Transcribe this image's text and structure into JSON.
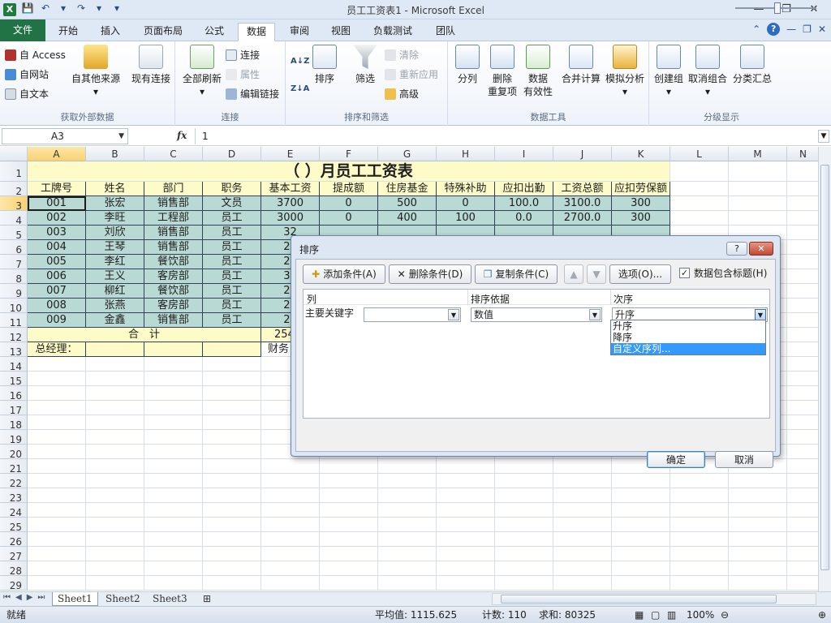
{
  "window": {
    "title": "员工工资表1 - Microsoft Excel",
    "minimize": "—",
    "restore": "❐",
    "close": "✕"
  },
  "qat": [
    "💾",
    "↶",
    "▾",
    "↷",
    "▾",
    "▾"
  ],
  "tabs": {
    "file": "文件",
    "items": [
      "开始",
      "插入",
      "页面布局",
      "公式",
      "数据",
      "审阅",
      "视图",
      "负载测试",
      "团队"
    ]
  },
  "ribbon": {
    "get_external": {
      "access": "自 Access",
      "web": "自网站",
      "text": "自文本",
      "other": "自其他来源",
      "existing": "现有连接",
      "label": "获取外部数据"
    },
    "connections": {
      "refresh_all": "全部刷新",
      "connections": "连接",
      "properties": "属性",
      "edit_links": "编辑链接",
      "label": "连接"
    },
    "sort_filter": {
      "sort_az": "A↓Z",
      "sort_za": "Z↓A",
      "sort": "排序",
      "filter": "筛选",
      "clear": "清除",
      "reapply": "重新应用",
      "advanced": "高级",
      "label": "排序和筛选"
    },
    "data_tools": {
      "text_to_columns": "分列",
      "remove_dup": "删除",
      "remove_dup2": "重复项",
      "validation": "数据",
      "validation2": "有效性",
      "consolidate": "合并计算",
      "what_if": "模拟分析",
      "label": "数据工具"
    },
    "outline": {
      "group": "创建组",
      "ungroup": "取消组合",
      "subtotal": "分类汇总",
      "label": "分级显示"
    }
  },
  "formula_bar": {
    "cell_ref": "A3",
    "fx": "fx",
    "value": "1"
  },
  "columns": [
    "A",
    "B",
    "C",
    "D",
    "E",
    "F",
    "G",
    "H",
    "I",
    "J",
    "K",
    "L",
    "M",
    "N"
  ],
  "rows": [
    "1",
    "2",
    "3",
    "4",
    "5",
    "6",
    "7",
    "8",
    "9",
    "10",
    "11",
    "12",
    "13",
    "14",
    "15",
    "16",
    "17",
    "18",
    "19",
    "20",
    "21",
    "22",
    "23",
    "24",
    "25",
    "26",
    "27",
    "28",
    "29"
  ],
  "sheet": {
    "title": "（ ）月员工工资表",
    "headers": [
      "工牌号",
      "姓名",
      "部门",
      "职务",
      "基本工资",
      "提成额",
      "住房基金",
      "特殊补助",
      "应扣出勤",
      "工资总额",
      "应扣劳保额"
    ],
    "data": [
      [
        "001",
        "张宏",
        "销售部",
        "文员",
        "3700",
        "0",
        "500",
        "0",
        "100.0",
        "3100.0",
        "300"
      ],
      [
        "002",
        "李旺",
        "工程部",
        "员工",
        "3000",
        "0",
        "400",
        "100",
        "0.0",
        "2700.0",
        "300"
      ],
      [
        "003",
        "刘欣",
        "销售部",
        "员工",
        "32",
        "",
        "",
        "",
        "",
        "",
        ""
      ],
      [
        "004",
        "王琴",
        "销售部",
        "员工",
        "25",
        "",
        "",
        "",
        "",
        "",
        ""
      ],
      [
        "005",
        "李红",
        "餐饮部",
        "员工",
        "28",
        "",
        "",
        "",
        "",
        "",
        ""
      ],
      [
        "006",
        "王义",
        "客房部",
        "员工",
        "34",
        "",
        "",
        "",
        "",
        "",
        ""
      ],
      [
        "007",
        "柳红",
        "餐饮部",
        "员工",
        "23",
        "",
        "",
        "",
        "",
        "",
        ""
      ],
      [
        "008",
        "张燕",
        "客房部",
        "员工",
        "21",
        "",
        "",
        "",
        "",
        "",
        ""
      ],
      [
        "009",
        "金鑫",
        "销售部",
        "员工",
        "23",
        "",
        "",
        "",
        "",
        "",
        ""
      ]
    ],
    "sum_label": "合　计",
    "sum_value": "254",
    "manager_label": "总经理：",
    "finance_label": "财务"
  },
  "sheet_tabs": [
    "Sheet1",
    "Sheet2",
    "Sheet3"
  ],
  "sheet_nav": [
    "⏮",
    "◀",
    "▶",
    "⏭"
  ],
  "status": {
    "ready": "就绪",
    "average": "平均值: 1115.625",
    "count": "计数: 110",
    "sum": "求和: 80325",
    "zoom": "100%",
    "zoom_out": "⊖",
    "zoom_in": "⊕"
  },
  "dialog": {
    "title": "排序",
    "help": "?",
    "close": "✕",
    "add_level": "添加条件(A)",
    "delete_level": "删除条件(D)",
    "copy_level": "复制条件(C)",
    "up": "▲",
    "down": "▼",
    "options": "选项(O)...",
    "has_header": "数据包含标题(H)",
    "col_header": "列",
    "sort_on_header": "排序依据",
    "order_header": "次序",
    "primary_key": "主要关键字",
    "column_value": "",
    "sort_on_value": "数值",
    "order_value": "升序",
    "order_options": [
      "升序",
      "降序",
      "自定义序列..."
    ],
    "ok": "确定",
    "cancel": "取消"
  }
}
